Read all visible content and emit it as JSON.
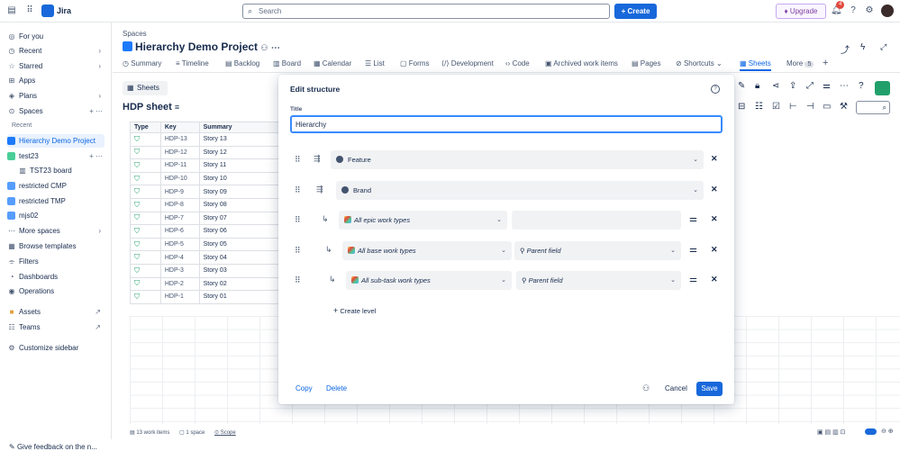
{
  "topbar": {
    "app_name": "Jira",
    "search_placeholder": "Search",
    "create_label": "+ Create",
    "upgrade_label": "Upgrade",
    "notifications_count": "4"
  },
  "sidebar": {
    "for_you": "For you",
    "recent": "Recent",
    "starred": "Starred",
    "apps": "Apps",
    "plans": "Plans",
    "spaces": "Spaces",
    "recent_section": "Recent",
    "projects": [
      "Hierarchy Demo Project",
      "test23",
      "TST23 board",
      "restricted CMP",
      "restricted TMP",
      "mjs02"
    ],
    "more_spaces": "More spaces",
    "browse_templates": "Browse templates",
    "filters": "Filters",
    "dashboards": "Dashboards",
    "operations": "Operations",
    "assets": "Assets",
    "teams": "Teams",
    "customize": "Customize sidebar",
    "feedback": "Give feedback on the n..."
  },
  "header": {
    "breadcrumb": "Spaces",
    "title": "Hierarchy Demo Project"
  },
  "tabs": [
    "Summary",
    "Timeline",
    "Backlog",
    "Board",
    "Calendar",
    "List",
    "Forms",
    "Development",
    "Code",
    "Archived work items",
    "Pages",
    "Shortcuts",
    "Sheets",
    "More"
  ],
  "more_count": "5",
  "sheet": {
    "button": "Sheets",
    "title": "HDP sheet",
    "columns": [
      "Type",
      "Key",
      "Summary"
    ],
    "rows": [
      {
        "key": "HDP-13",
        "summary": "Story 13"
      },
      {
        "key": "HDP-12",
        "summary": "Story 12"
      },
      {
        "key": "HDP-11",
        "summary": "Story 11"
      },
      {
        "key": "HDP-10",
        "summary": "Story 10"
      },
      {
        "key": "HDP-9",
        "summary": "Story 09"
      },
      {
        "key": "HDP-8",
        "summary": "Story 08"
      },
      {
        "key": "HDP-7",
        "summary": "Story 07"
      },
      {
        "key": "HDP-6",
        "summary": "Story 06"
      },
      {
        "key": "HDP-5",
        "summary": "Story 05"
      },
      {
        "key": "HDP-4",
        "summary": "Story 04"
      },
      {
        "key": "HDP-3",
        "summary": "Story 03"
      },
      {
        "key": "HDP-2",
        "summary": "Story 02"
      },
      {
        "key": "HDP-1",
        "summary": "Story 01"
      }
    ],
    "status": {
      "work_items": "13 work items",
      "spaces": "1 space",
      "scope": "Scope"
    }
  },
  "modal": {
    "title": "Edit structure",
    "title_label": "Title",
    "title_value": "Hierarchy",
    "levels": [
      {
        "primary": "Feature",
        "italic": false,
        "secondary": null
      },
      {
        "primary": "Brand",
        "italic": false,
        "secondary": null
      },
      {
        "primary": "All epic work types",
        "italic": true,
        "secondary": ""
      },
      {
        "primary": "All base work types",
        "italic": true,
        "secondary": "Parent field"
      },
      {
        "primary": "All sub-task work types",
        "italic": true,
        "secondary": "Parent field"
      }
    ],
    "create_level": "Create level",
    "copy": "Copy",
    "delete": "Delete",
    "cancel": "Cancel",
    "save": "Save"
  }
}
